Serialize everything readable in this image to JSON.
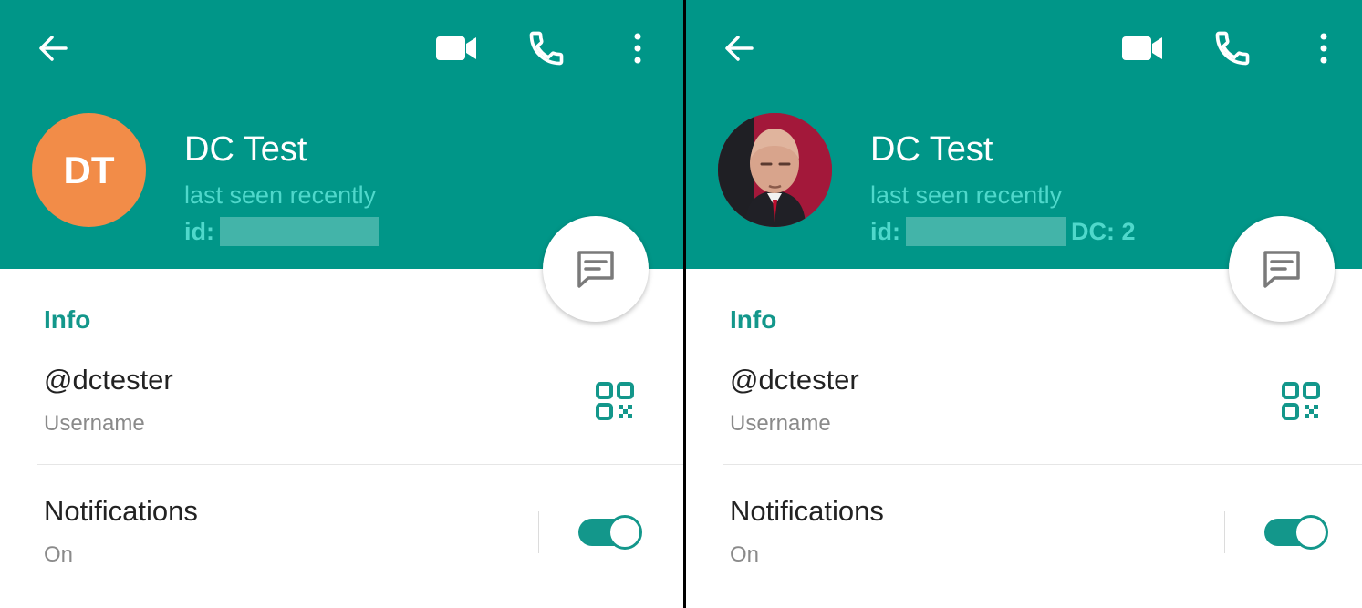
{
  "colors": {
    "header": "#009688",
    "accent": "#13978b",
    "status_text": "#4fd8cb",
    "avatar_initials_bg": "#f28c48"
  },
  "toolbar": {
    "icons": [
      "back-arrow-icon",
      "video-call-icon",
      "phone-icon",
      "more-vert-icon"
    ]
  },
  "left": {
    "avatar_initials": "DT",
    "name": "DC Test",
    "status": "last seen recently",
    "id_label": "id:",
    "info_title": "Info",
    "username": "@dctester",
    "username_label": "Username",
    "notifications_title": "Notifications",
    "notifications_state": "On",
    "notifications_enabled": true
  },
  "right": {
    "name": "DC Test",
    "status": "last seen recently",
    "id_label": "id:",
    "dc_label": "DC: 2",
    "info_title": "Info",
    "username": "@dctester",
    "username_label": "Username",
    "notifications_title": "Notifications",
    "notifications_state": "On",
    "notifications_enabled": true
  }
}
